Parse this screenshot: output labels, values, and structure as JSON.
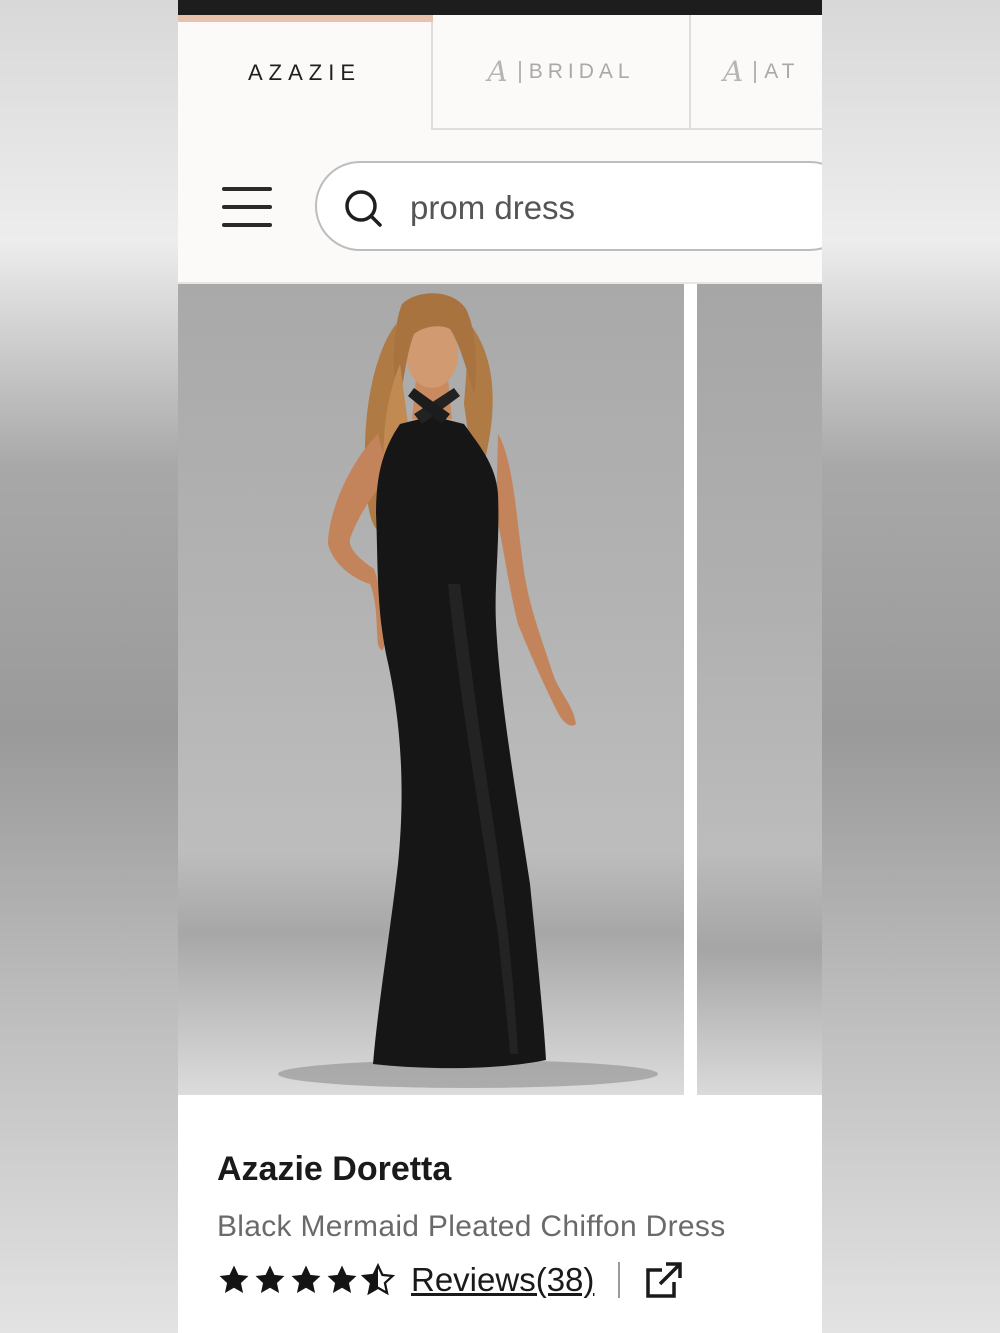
{
  "brands": {
    "active": "AZAZIE",
    "bridal": "BRIDAL",
    "at": "AT",
    "logo_glyph": "A"
  },
  "search": {
    "value": "prom dress"
  },
  "product": {
    "name": "Azazie Doretta",
    "description": "Black Mermaid Pleated Chiffon Dress",
    "rating": 4.5,
    "reviews_label": "Reviews(38)"
  },
  "colors": {
    "accent_tab": "#e8c2ab",
    "topbar": "#1d1d1d",
    "dress": "#161616"
  },
  "icons": [
    "menu-icon",
    "search-icon",
    "star-icon",
    "share-external-icon"
  ]
}
